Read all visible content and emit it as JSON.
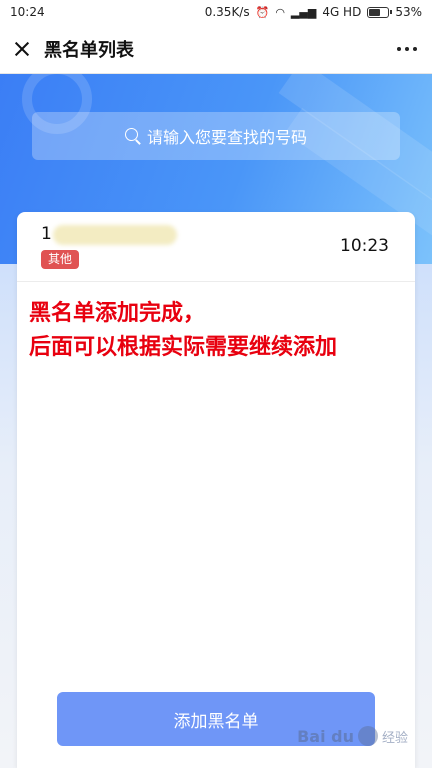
{
  "status_bar": {
    "time": "10:24",
    "speed": "0.35K/s",
    "network": "4G HD",
    "battery": "53%"
  },
  "header": {
    "title": "黑名单列表"
  },
  "search": {
    "placeholder": "请输入您要查找的号码"
  },
  "list": {
    "items": [
      {
        "number": "1",
        "tag": "其他",
        "time": "10:23"
      }
    ]
  },
  "annotation": {
    "line1": "黑名单添加完成，",
    "line2": "后面可以根据实际需要继续添加"
  },
  "footer": {
    "add_button_label": "添加黑名单"
  },
  "watermark": {
    "brand": "Bai du",
    "suffix": "经验"
  },
  "colors": {
    "accent_blue": "#4a8df6",
    "button_blue": "#6f96f7",
    "tag_red": "#e05353",
    "annotation_red": "#e8000f"
  }
}
